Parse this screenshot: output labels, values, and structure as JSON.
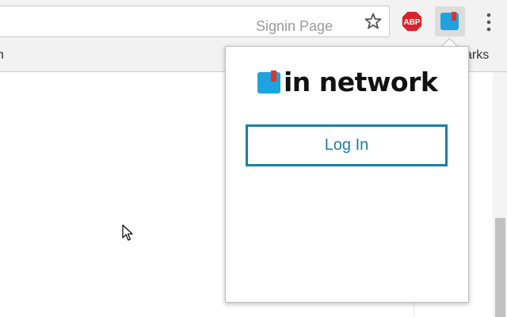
{
  "browser": {
    "omnibox_text": "Signin Page",
    "bookmarks_left_text": "h",
    "bookmarks_right_text": "arks",
    "extensions": {
      "abp_label": "ABP"
    }
  },
  "popup": {
    "logo_text": "in network",
    "login_button_label": "Log In"
  },
  "colors": {
    "accent": "#1a7fa8",
    "logo_blue": "#1ea3e0",
    "logo_red": "#e0342b",
    "abp_red": "#d9232a"
  },
  "icons": {
    "star": "star-icon",
    "abp": "abp-icon",
    "extension": "in-network-extension-icon",
    "menu": "kebab-menu-icon",
    "cursor": "mouse-pointer-icon"
  }
}
